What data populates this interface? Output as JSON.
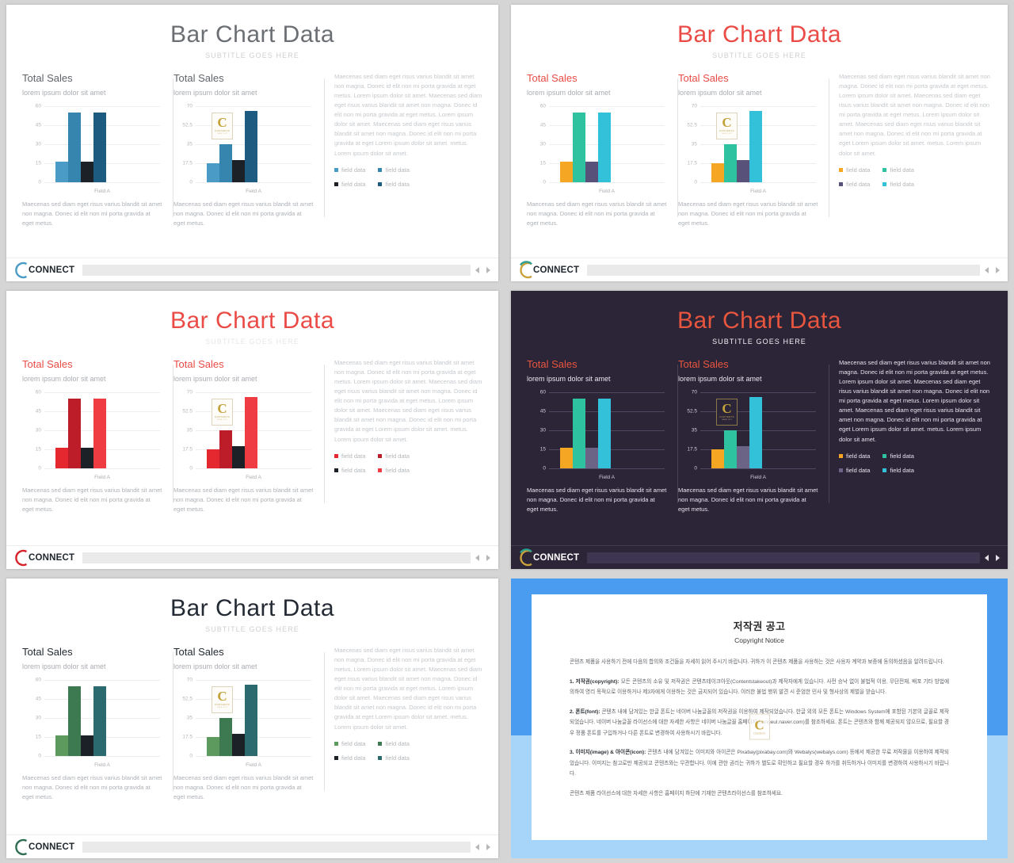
{
  "deck": {
    "title": "Bar Chart Data",
    "subtitle": "SUBTITLE GOES HERE",
    "section_heading": "Total Sales",
    "section_subheading": "lorem ipsum dolor sit amet",
    "blurb": "Maecenas sed diam eget risus varius blandit sit amet non magna. Donec id elit non mi porta gravida at eget metus.",
    "longtext": "Maecenas sed diam eget risus varius blandit sit amet non magna. Donec id elit non mi porta gravida at eget metus. Lorem ipsum dolor sit amet. Maecenas sed diam eget risus varius blandit sit amet non magna. Donec id elit non mi porta gravida at eget metus. Lorem ipsum dolor sit amet. Maecenas sed diam eget risus varius blandit sit amet non magna. Donec id elit non mi porta gravida at eget Lorem ipsum dolor sit amet. metus. Lorem ipsum dolor sit amet.",
    "legend_label": "field data",
    "logo_text": "CONNECT",
    "watermark_c": "C",
    "watermark_label": "CONTENTS",
    "watermark_sub": "TAKE OUT",
    "nav_prev": "◀",
    "nav_next": "▶"
  },
  "chart_data": [
    {
      "type": "bar",
      "slide": 1,
      "theme": "blue",
      "title": "Total Sales",
      "subtitle": "lorem ipsum dolor sit amet",
      "xlabel": "Field A",
      "ylabel": "",
      "categories": [
        "field data",
        "field data",
        "field data",
        "field data"
      ],
      "values": [
        16,
        55,
        16,
        55
      ],
      "ylim": [
        0,
        60
      ],
      "yticks": [
        0,
        15,
        30,
        45,
        60
      ],
      "colors": [
        "#4a9bc6",
        "#3685ae",
        "#1c2127",
        "#1d5c80"
      ],
      "grid": true,
      "legend": "right"
    },
    {
      "type": "bar",
      "slide": 1,
      "theme": "blue",
      "title": "Total Sales",
      "subtitle": "lorem ipsum dolor sit amet",
      "xlabel": "Field A",
      "ylabel": "",
      "categories": [
        "field data",
        "field data",
        "field data",
        "field data"
      ],
      "values": [
        17.5,
        35,
        20,
        65
      ],
      "ylim": [
        0,
        70
      ],
      "yticks": [
        0,
        17.5,
        35,
        52.5,
        70
      ],
      "colors": [
        "#4a9bc6",
        "#3685ae",
        "#1c2127",
        "#1d5c80"
      ],
      "grid": true,
      "legend": "right"
    },
    {
      "type": "bar",
      "slide": 2,
      "theme": "multicolor",
      "title": "Total Sales",
      "subtitle": "lorem ipsum dolor sit amet",
      "xlabel": "Field A",
      "categories": [
        "field data",
        "field data",
        "field data",
        "field data"
      ],
      "values": [
        16,
        55,
        16,
        55
      ],
      "ylim": [
        0,
        60
      ],
      "yticks": [
        0,
        15,
        30,
        45,
        60
      ],
      "colors": [
        "#f5a623",
        "#2ec2a0",
        "#58527a",
        "#33c1da"
      ],
      "grid": true,
      "legend": "right"
    },
    {
      "type": "bar",
      "slide": 2,
      "theme": "multicolor",
      "title": "Total Sales",
      "subtitle": "lorem ipsum dolor sit amet",
      "xlabel": "Field A",
      "categories": [
        "field data",
        "field data",
        "field data",
        "field data"
      ],
      "values": [
        17.5,
        35,
        20,
        65
      ],
      "ylim": [
        0,
        70
      ],
      "yticks": [
        0,
        17.5,
        35,
        52.5,
        70
      ],
      "colors": [
        "#f5a623",
        "#2ec2a0",
        "#58527a",
        "#33c1da"
      ],
      "grid": true,
      "legend": "right"
    },
    {
      "type": "bar",
      "slide": 3,
      "theme": "red",
      "title": "Total Sales",
      "subtitle": "lorem ipsum dolor sit amet",
      "xlabel": "Field A",
      "categories": [
        "field data",
        "field data",
        "field data",
        "field data"
      ],
      "values": [
        16,
        55,
        16,
        55
      ],
      "ylim": [
        0,
        60
      ],
      "yticks": [
        0,
        15,
        30,
        45,
        60
      ],
      "colors": [
        "#e5272f",
        "#bc1d28",
        "#1c2127",
        "#ef3b42"
      ],
      "grid": true,
      "legend": "right"
    },
    {
      "type": "bar",
      "slide": 3,
      "theme": "red",
      "title": "Total Sales",
      "subtitle": "lorem ipsum dolor sit amet",
      "xlabel": "Field A",
      "categories": [
        "field data",
        "field data",
        "field data",
        "field data"
      ],
      "values": [
        17.5,
        35,
        20,
        65
      ],
      "ylim": [
        0,
        70
      ],
      "yticks": [
        0,
        17.5,
        35,
        52.5,
        70
      ],
      "colors": [
        "#e5272f",
        "#bc1d28",
        "#1c2127",
        "#ef3b42"
      ],
      "grid": true,
      "legend": "right"
    },
    {
      "type": "bar",
      "slide": 4,
      "theme": "dark",
      "title": "Total Sales",
      "subtitle": "lorem ipsum dolor sit amet",
      "xlabel": "Field A",
      "categories": [
        "field data",
        "field data",
        "field data",
        "field data"
      ],
      "values": [
        16,
        55,
        16,
        55
      ],
      "ylim": [
        0,
        60
      ],
      "yticks": [
        0,
        15,
        30,
        45,
        60
      ],
      "colors": [
        "#f5a623",
        "#2ec2a0",
        "#6b6486",
        "#33c1da"
      ],
      "grid": true,
      "legend": "right"
    },
    {
      "type": "bar",
      "slide": 4,
      "theme": "dark",
      "title": "Total Sales",
      "subtitle": "lorem ipsum dolor sit amet",
      "xlabel": "Field A",
      "categories": [
        "field data",
        "field data",
        "field data",
        "field data"
      ],
      "values": [
        17.5,
        35,
        20,
        65
      ],
      "ylim": [
        0,
        70
      ],
      "yticks": [
        0,
        17.5,
        35,
        52.5,
        70
      ],
      "colors": [
        "#f5a623",
        "#2ec2a0",
        "#6b6486",
        "#33c1da"
      ],
      "grid": true,
      "legend": "right"
    },
    {
      "type": "bar",
      "slide": 5,
      "theme": "green",
      "title": "Total Sales",
      "subtitle": "lorem ipsum dolor sit amet",
      "xlabel": "Field A",
      "categories": [
        "field data",
        "field data",
        "field data",
        "field data"
      ],
      "values": [
        16,
        55,
        16,
        55
      ],
      "ylim": [
        0,
        60
      ],
      "yticks": [
        0,
        15,
        30,
        45,
        60
      ],
      "colors": [
        "#5d9a5e",
        "#3d7a52",
        "#1c2127",
        "#2b6a6e"
      ],
      "grid": true,
      "legend": "right"
    },
    {
      "type": "bar",
      "slide": 5,
      "theme": "green",
      "title": "Total Sales",
      "subtitle": "lorem ipsum dolor sit amet",
      "xlabel": "Field A",
      "categories": [
        "field data",
        "field data",
        "field data",
        "field data"
      ],
      "values": [
        17.5,
        35,
        20,
        65
      ],
      "ylim": [
        0,
        70
      ],
      "yticks": [
        0,
        17.5,
        35,
        52.5,
        70
      ],
      "colors": [
        "#5d9a5e",
        "#3d7a52",
        "#1c2127",
        "#2b6a6e"
      ],
      "grid": true,
      "legend": "right"
    }
  ],
  "ticks": {
    "set60": [
      "60",
      "45",
      "30",
      "15",
      "0"
    ],
    "set70": [
      "70",
      "52.5",
      "35",
      "17.5",
      "0"
    ]
  },
  "copyright": {
    "title_ko": "저작권 공고",
    "title_en": "Copyright Notice",
    "intro": "콘텐츠 제품을 사용하기 전에 다음의 합의와 조건들을 자세히 읽어 주시기 바랍니다. 귀하가 이 콘텐츠 제품을 사용하는 것은 사용자 계약과 보증에 동의하셨음을 알려드립니다.",
    "clause1_label": "1. 저작권(copyright):",
    "clause1": " 모든 콘텐츠의 소유 및 저작권은 콘텐츠테이크아웃(Contentstakeout)과 제작자에게 있습니다. 사전 승낙 없이 불법적 이용, 무단전재, 배포 기타 방법에 의하여 영리 목적으로 이용하거나 제3자에게 이용하는 것은 금지되어 있습니다. 이러한 불법 행위 발견 시 준엄한 민사 및 형사상의 제벌을 받습니다.",
    "clause2_label": "2. 폰트(font):",
    "clause2": " 콘텐츠 내에 담겨있는 한글 폰트는 네이버 나눔글꼴의 저작권을 이용하여 제작되었습니다. 한글 외의 모든 폰트는 Windows System에 포함된 기본의 글꼴로 제작되었습니다. 네이버 나눔글꼴 라이선스에 대한 자세한 사항은 네이버 나눔글꼴 홈페이지(hangeul.naver.com)를 참조하세요. 폰트는 콘텐츠와 함께 제공되지 않으므로, 필요할 경우 정품 폰트를 구입하거나 다른 폰트로 변경하여 사용하시기 바랍니다.",
    "clause3_label": "3. 이미지(image) & 아이콘(icon):",
    "clause3": " 콘텐츠 내에 담겨있는 이미지와 아이콘은 Pixabay(pixabay.com)와 Webalys(webalys.com) 등에서 제공한 무료 저작물을 이용하여 제작되었습니다. 이미지는 참고로만 제공되고 콘텐츠와는 무관합니다. 이에 관한 권리는 귀하가 별도로 확인하고 필요할 경우 하가를 취득하거나 이미지를 변경하여 사용하시기 바랍니다.",
    "outro": "콘텐츠 제품 라이선스에 대한 자세한 사항은 홈페이지 하단에 기재한 콘텐츠라이선스를 참조하세요."
  }
}
